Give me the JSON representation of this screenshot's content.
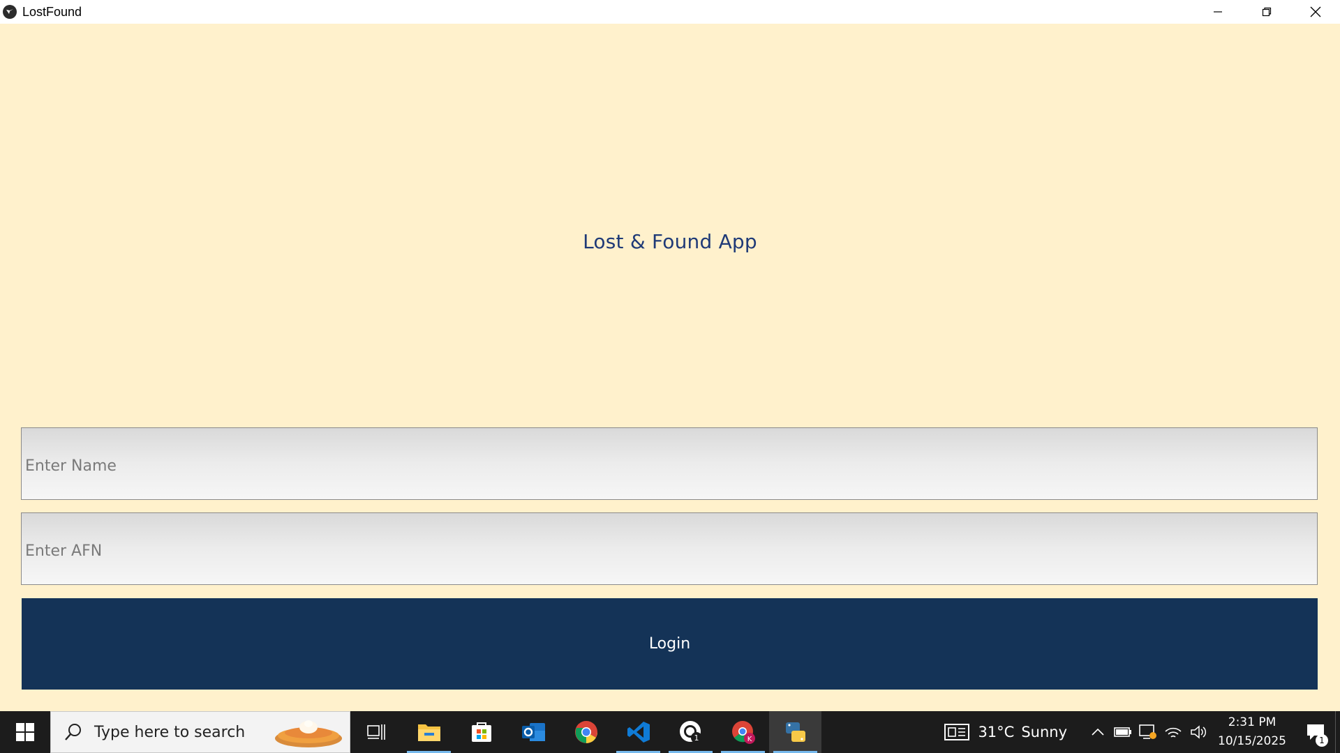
{
  "window": {
    "title": "LostFound",
    "controls": [
      "minimize-icon",
      "restore-icon",
      "close-icon"
    ]
  },
  "app": {
    "heading": "Lost & Found App",
    "name_field": {
      "placeholder": "Enter Name",
      "value": ""
    },
    "afn_field": {
      "placeholder": "Enter AFN",
      "value": ""
    },
    "login_label": "Login",
    "colors": {
      "background": "#fff1cc",
      "heading": "#1f3a77",
      "login_button": "#143357",
      "login_text": "#ffffff"
    }
  },
  "taskbar": {
    "search_placeholder": "Type here to search",
    "apps": [
      {
        "name": "task-view-icon",
        "running": false
      },
      {
        "name": "file-explorer-icon",
        "running": true
      },
      {
        "name": "microsoft-store-icon",
        "running": false
      },
      {
        "name": "outlook-icon",
        "running": false
      },
      {
        "name": "chrome-icon",
        "running": false
      },
      {
        "name": "vscode-icon",
        "running": true
      },
      {
        "name": "chrome-profile-1-icon",
        "running": true
      },
      {
        "name": "chrome-profile-k-icon",
        "running": true
      },
      {
        "name": "python-icon",
        "running": true,
        "active": true
      }
    ],
    "weather": {
      "temp": "31°C",
      "condition": "Sunny"
    },
    "clock": {
      "time": "2:31 PM",
      "date": "10/15/2025"
    },
    "notification_count": "1"
  }
}
